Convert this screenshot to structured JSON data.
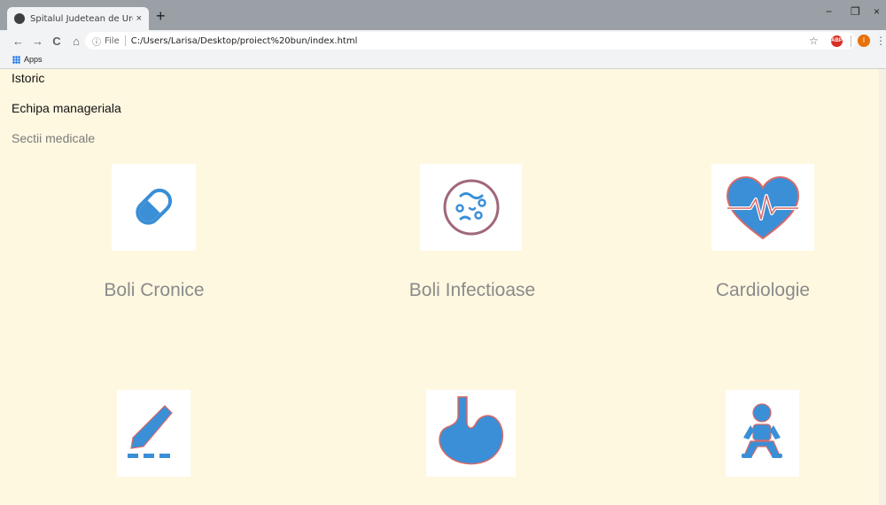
{
  "browser": {
    "tab_title": "Spitalul Judetean de Urgenta Bu",
    "tab_close": "×",
    "new_tab": "+",
    "minimize": "−",
    "restore": "❐",
    "close": "×",
    "nav": {
      "back": "←",
      "forward": "→",
      "reload": "C",
      "home": "⌂"
    },
    "omnibox": {
      "info": "ⓘ",
      "scheme": "File",
      "url": "C:/Users/Larisa/Desktop/proiect%20bun/index.html"
    },
    "star": "☆",
    "ext_abp": "ABP",
    "avatar": "I",
    "menu": "⋮",
    "bookmarks": {
      "apps": "Apps"
    }
  },
  "page": {
    "nav": [
      {
        "label": "Istoric"
      },
      {
        "label": "Echipa manageriala"
      },
      {
        "label": "Sectii medicale"
      }
    ],
    "sections": [
      {
        "label": "Boli Cronice",
        "icon": "pill-icon"
      },
      {
        "label": "Boli Infectioase",
        "icon": "bacteria-icon"
      },
      {
        "label": "Cardiologie",
        "icon": "heart-pulse-icon"
      },
      {
        "label": "",
        "icon": "scalpel-icon"
      },
      {
        "label": "",
        "icon": "stomach-icon"
      },
      {
        "label": "",
        "icon": "baby-icon"
      }
    ],
    "colors": {
      "background": "#fff8e1",
      "icon_blue": "#3a8fd6",
      "icon_outline": "#c96a6a"
    }
  }
}
